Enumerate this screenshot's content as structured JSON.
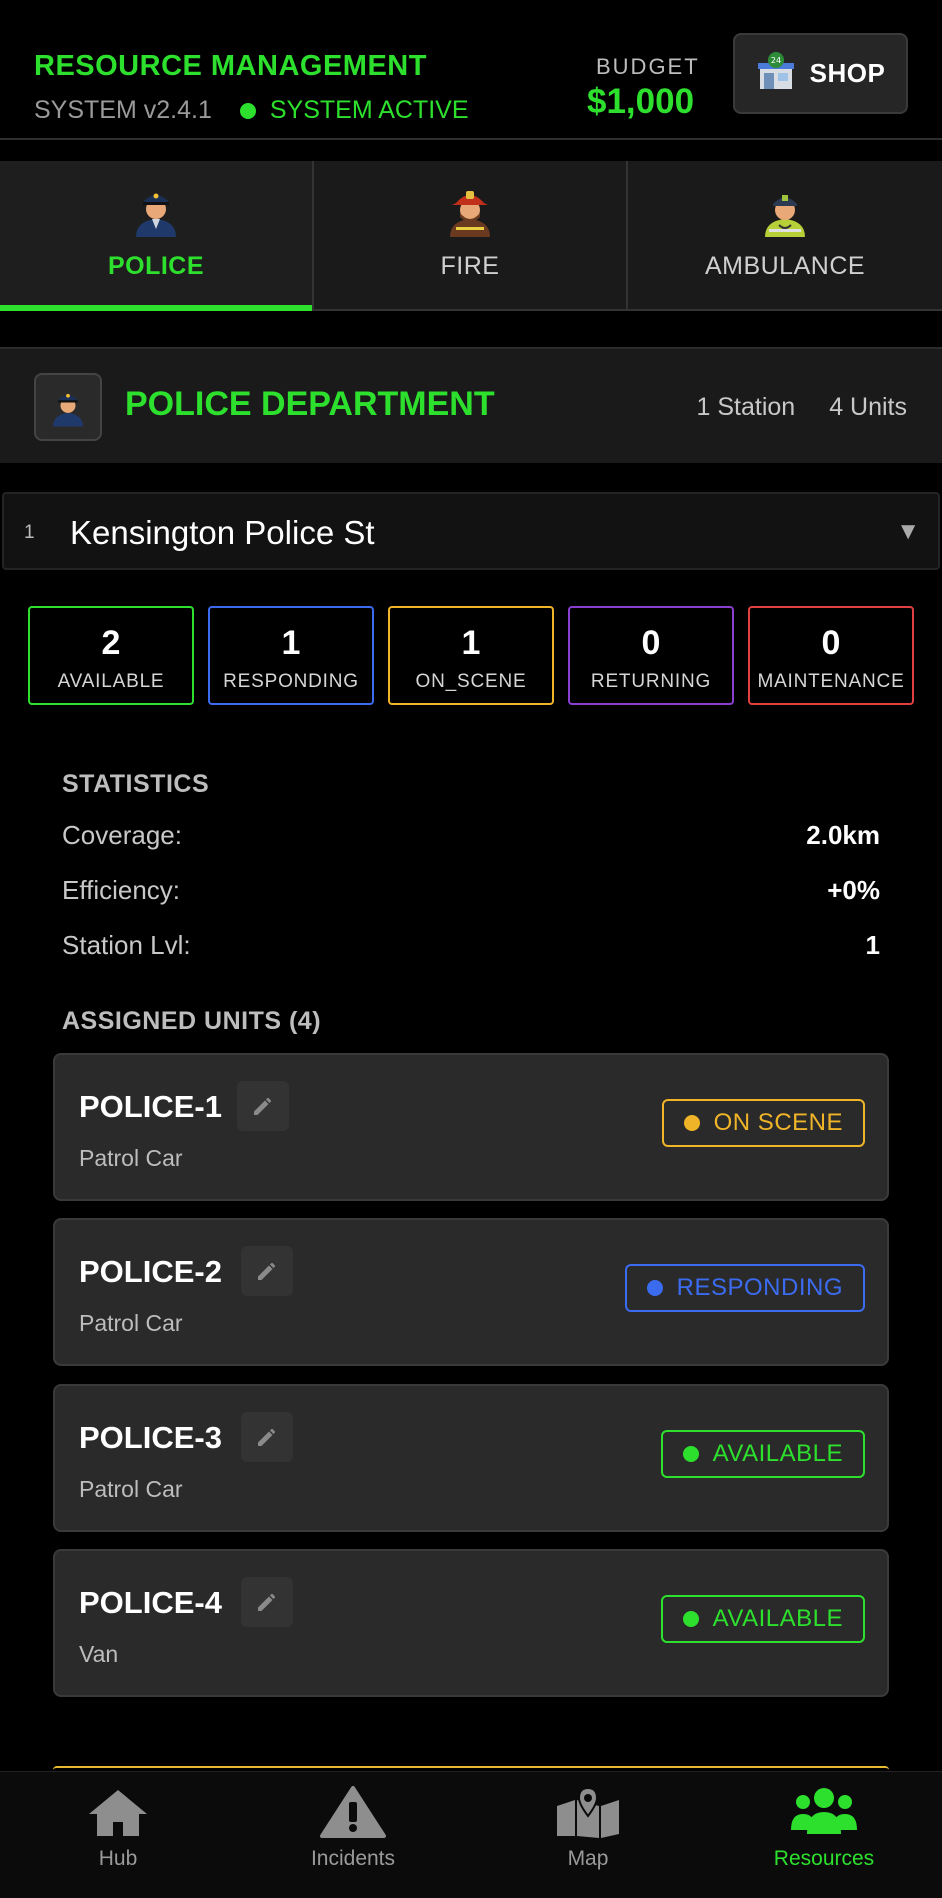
{
  "header": {
    "title": "RESOURCE MANAGEMENT",
    "version": "SYSTEM v2.4.1",
    "system_status": "SYSTEM ACTIVE",
    "budget_label": "BUDGET",
    "budget_value": "$1,000",
    "shop_label": "SHOP",
    "shop_icon_badge": "24",
    "accent_color": "#2ee02e"
  },
  "tabs": [
    {
      "label": "POLICE",
      "icon": "police-officer-icon",
      "active": true
    },
    {
      "label": "FIRE",
      "icon": "firefighter-icon",
      "active": false
    },
    {
      "label": "AMBULANCE",
      "icon": "paramedic-icon",
      "active": false
    }
  ],
  "department": {
    "title": "POLICE DEPARTMENT",
    "stations": "1 Station",
    "units": "4 Units"
  },
  "station": {
    "number": "1",
    "name": "Kensington Police St",
    "caret": "▼"
  },
  "counters": [
    {
      "value": "2",
      "label": "AVAILABLE",
      "color": "#2ee02e"
    },
    {
      "value": "1",
      "label": "RESPONDING",
      "color": "#3b6cf0"
    },
    {
      "value": "1",
      "label": "ON_SCENE",
      "color": "#f0b429"
    },
    {
      "value": "0",
      "label": "RETURNING",
      "color": "#8a3fd0"
    },
    {
      "value": "0",
      "label": "MAINTENANCE",
      "color": "#e04040"
    }
  ],
  "statistics": {
    "title": "STATISTICS",
    "rows": [
      {
        "label": "Coverage:",
        "value": "2.0km"
      },
      {
        "label": "Efficiency:",
        "value": "+0%"
      },
      {
        "label": "Station Lvl:",
        "value": "1"
      }
    ]
  },
  "assigned": {
    "title": "ASSIGNED UNITS (4)",
    "units": [
      {
        "name": "POLICE-1",
        "type": "Patrol Car",
        "status": "ON SCENE",
        "status_color": "#f0b429"
      },
      {
        "name": "POLICE-2",
        "type": "Patrol Car",
        "status": "RESPONDING",
        "status_color": "#3b6cf0"
      },
      {
        "name": "POLICE-3",
        "type": "Patrol Car",
        "status": "AVAILABLE",
        "status_color": "#2ee02e"
      },
      {
        "name": "POLICE-4",
        "type": "Van",
        "status": "AVAILABLE",
        "status_color": "#2ee02e"
      }
    ]
  },
  "nav": [
    {
      "label": "Hub",
      "icon": "home-icon",
      "active": false
    },
    {
      "label": "Incidents",
      "icon": "warning-icon",
      "active": false
    },
    {
      "label": "Map",
      "icon": "map-icon",
      "active": false
    },
    {
      "label": "Resources",
      "icon": "people-icon",
      "active": true
    }
  ]
}
